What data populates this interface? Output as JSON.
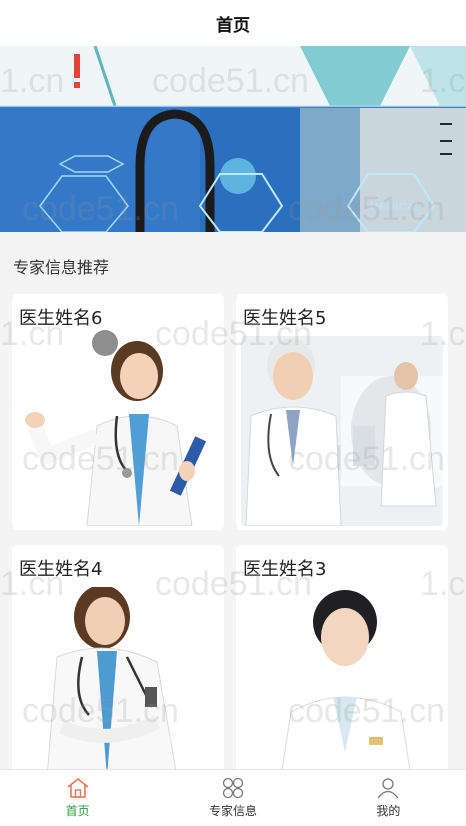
{
  "header": {
    "title": "首页"
  },
  "banner": {
    "overlay_text": "MEDICAL"
  },
  "section": {
    "title": "专家信息推荐"
  },
  "doctors": [
    {
      "name": "医生姓名6"
    },
    {
      "name": "医生姓名5"
    },
    {
      "name": "医生姓名4"
    },
    {
      "name": "医生姓名3"
    }
  ],
  "watermark": "code51.cn",
  "watermark_short": "1.cn",
  "tabbar": {
    "active_color": "#2e9a3b",
    "items": [
      {
        "label": "首页",
        "icon": "home-icon",
        "active": true
      },
      {
        "label": "专家信息",
        "icon": "grid-icon",
        "active": false
      },
      {
        "label": "我的",
        "icon": "user-icon",
        "active": false
      }
    ]
  }
}
